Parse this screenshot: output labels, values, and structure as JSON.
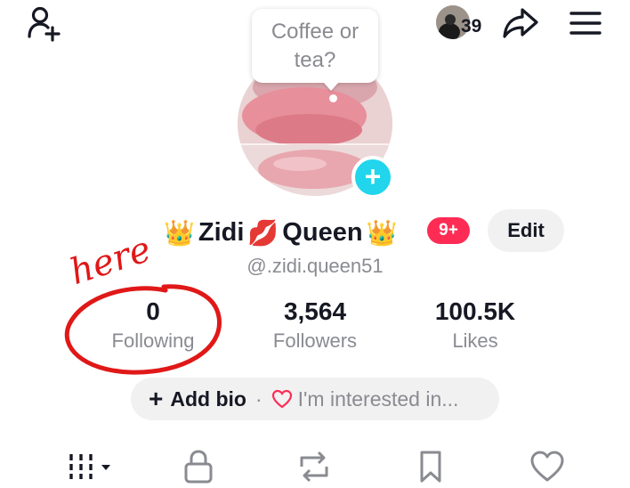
{
  "header": {
    "story_count": "39"
  },
  "bubble": {
    "text_line1": "Coffee or",
    "text_line2": "tea?"
  },
  "profile": {
    "name": "Zidi",
    "name_part2": "Queen",
    "badge": "9+",
    "edit_label": "Edit",
    "handle": "@.zidi.queen51"
  },
  "stats": [
    {
      "value": "0",
      "label": "Following"
    },
    {
      "value": "3,564",
      "label": "Followers"
    },
    {
      "value": "100.5K",
      "label": "Likes"
    }
  ],
  "bio": {
    "add_label": "Add bio",
    "separator": "·",
    "interest_label": "I'm interested in..."
  },
  "annotation": {
    "text": "here"
  },
  "icons": {
    "add_friend": "add-friend-icon",
    "share": "share-icon",
    "menu": "menu-icon",
    "videos_tab": "grid-icon",
    "private_tab": "lock-icon",
    "reposts_tab": "repost-icon",
    "saved_tab": "bookmark-icon",
    "liked_tab": "heart-icon"
  },
  "colors": {
    "accent_pink": "#fe2c55",
    "avatar_add": "#20d5ec",
    "annotation_red": "#e01818",
    "secondary_text": "#8a8b91",
    "pill_bg": "#f1f1f2"
  }
}
